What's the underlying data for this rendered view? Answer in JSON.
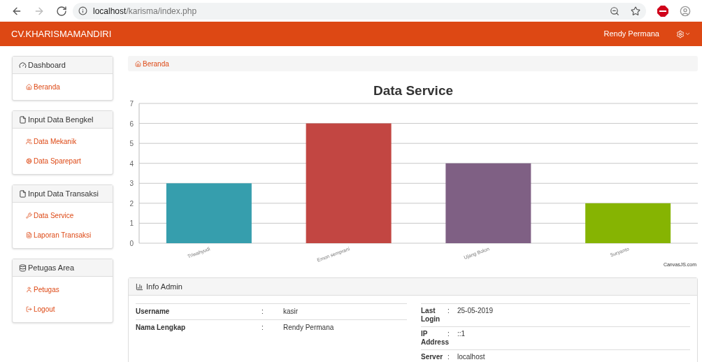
{
  "browser": {
    "url_host": "localhost",
    "url_path": "/karisma/index.php"
  },
  "navbar": {
    "brand": "CV.KHARISMAMANDIRI",
    "user": "Rendy Permana"
  },
  "sidebar": [
    {
      "title": "Dashboard",
      "items": [
        {
          "label": "Beranda"
        }
      ]
    },
    {
      "title": "Input Data Bengkel",
      "items": [
        {
          "label": "Data Mekanik"
        },
        {
          "label": "Data Sparepart"
        }
      ]
    },
    {
      "title": "Input Data Transaksi",
      "items": [
        {
          "label": "Data Service"
        },
        {
          "label": "Laporan Transaksi"
        }
      ]
    },
    {
      "title": "Petugas Area",
      "items": [
        {
          "label": "Petugas"
        },
        {
          "label": "Logout"
        }
      ]
    }
  ],
  "breadcrumb": "Beranda",
  "chart": {
    "credit": "CanvasJS.com",
    "chart_data": {
      "type": "bar",
      "title": "Data Service",
      "categories": [
        "Triwahyudi",
        "Emon semprani",
        "Ujang Bolon",
        "Suryanto"
      ],
      "series": [
        {
          "values": [
            3,
            6,
            4,
            2
          ]
        }
      ],
      "ylim": [
        0,
        7
      ],
      "yticks": [
        0,
        1,
        2,
        3,
        4,
        5,
        6,
        7
      ],
      "grid": true
    }
  },
  "info_admin": {
    "title": "Info Admin",
    "left_rows": [
      {
        "label": "Username",
        "colon": ":",
        "value": "kasir"
      },
      {
        "label": "Nama Lengkap",
        "colon": ":",
        "value": "Rendy Permana"
      }
    ],
    "right_rows": [
      {
        "label": "Last Login",
        "colon": ":",
        "value": "25-05-2019"
      },
      {
        "label": "IP Address",
        "colon": ":",
        "value": "::1"
      },
      {
        "label": "Server",
        "colon": ":",
        "value": "localhost"
      }
    ]
  }
}
